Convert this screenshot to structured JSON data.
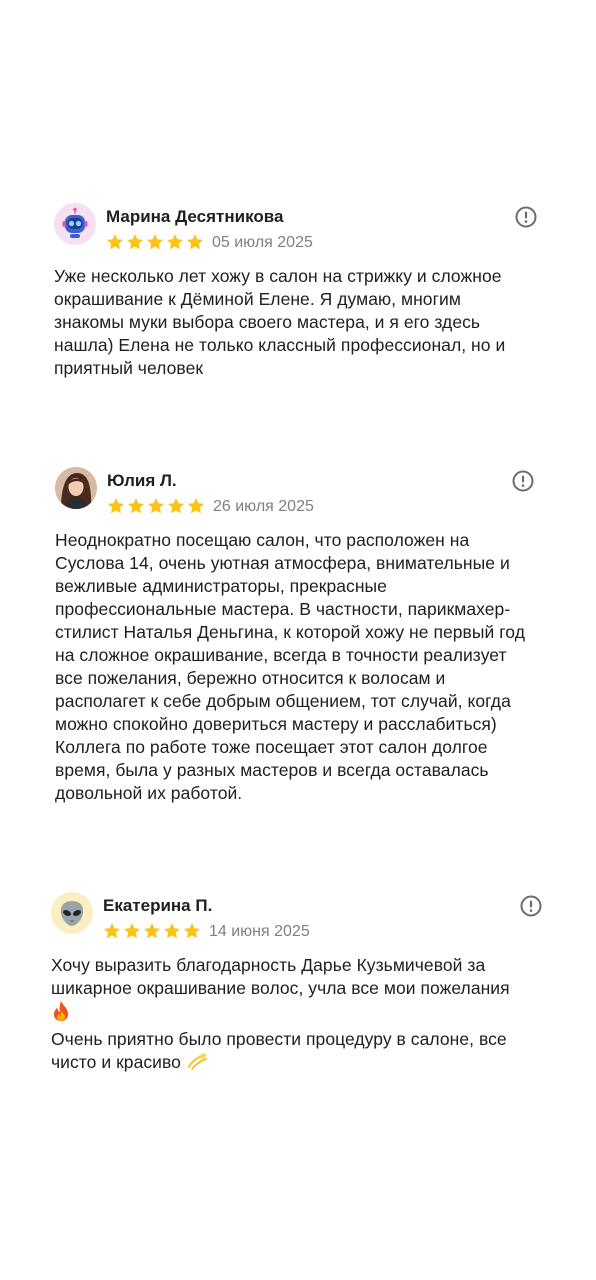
{
  "reviews": [
    {
      "author": "Марина Десятникова",
      "avatar_icon": "robot-avatar-icon",
      "rating": 5,
      "date": "05 июля 2025",
      "text": "Уже несколько лет хожу в салон на стрижку и сложное\nокрашивание к Дёминой Елене. Я думаю, многим\nзнакомы муки выбора своего мастера, и я его здесь\nнашла) Елена не только классный профессионал, но и\nприятный человек"
    },
    {
      "author": "Юлия Л.",
      "avatar_icon": "user-photo-avatar",
      "rating": 5,
      "date": "26 июля 2025",
      "text": "Неоднократно посещаю салон, что расположен на\nСуслова 14, очень уютная атмосфера, внимательные и\nвежливые администраторы, прекрасные\nпрофессиональные мастера. В частности, парикмахер-\nстилист Наталья Деньгина, к которой хожу не первый год\nна сложное окрашивание, всегда в точности реализует\nвсе пожелания, бережно относится к волосам и\nрасполагет к себе добрым общением, тот случай, когда\nможно спокойно довериться мастеру и расслабиться)\nКоллега по работе тоже посещает этот салон долгое\nвремя, была у разных мастеров и всегда оставалась\nдовольной их работой."
    },
    {
      "author": "Екатерина П.",
      "avatar_icon": "alien-avatar-icon",
      "rating": 5,
      "date": "14 июня 2025",
      "text_line1": "Хочу выразить благодарность Дарье Кузьмичевой за\nшикарное окрашивание волос, учла все мои пожелания",
      "text_line2": "Очень приятно было провести процедуру в салоне, все\nчисто и красиво",
      "emoji1": "fire-emoji",
      "emoji2": "dizzy-emoji"
    }
  ],
  "colors": {
    "star": "#fcc419",
    "date": "#7f7f84",
    "text": "#21201f",
    "report_icon": "#6b6b70"
  }
}
